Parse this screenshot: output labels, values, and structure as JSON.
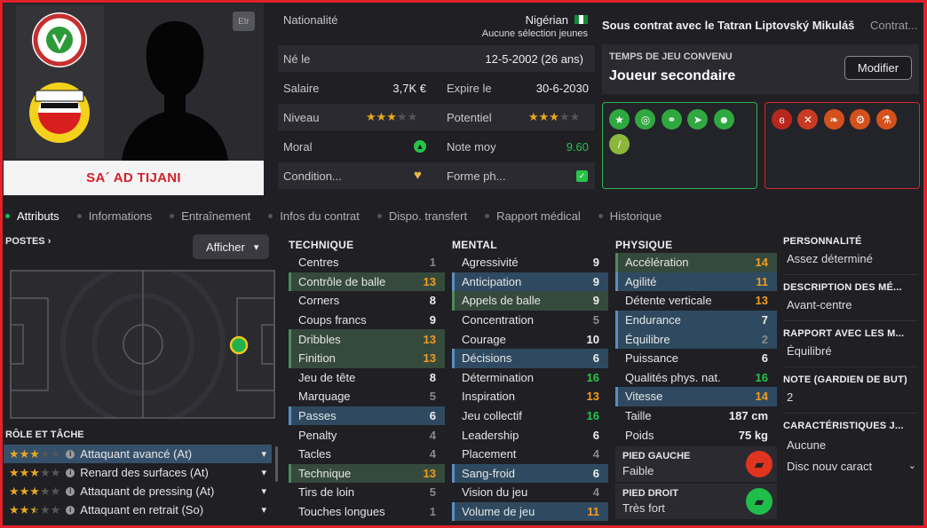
{
  "player": {
    "name": "SA´ AD TIJANI",
    "badge": "Etr"
  },
  "info": {
    "nationality_label": "Nationalité",
    "nationality_value": "Nigérian",
    "nationality_sub": "Aucune sélection jeunes",
    "born_label": "Né le",
    "born_value": "12-5-2002 (26 ans)",
    "salary_label": "Salaire",
    "salary_value": "3,7K €",
    "expire_label": "Expire le",
    "expire_value": "30-6-2030",
    "level_label": "Niveau",
    "level_stars": 3,
    "potential_label": "Potentiel",
    "potential_stars": 3,
    "morale_label": "Moral",
    "avg_label": "Note moy",
    "avg_value": "9.60",
    "condition_label": "Condition...",
    "form_label": "Forme ph..."
  },
  "contract": {
    "title": "Sous contrat avec le Tatran Liptovský Mikuláš",
    "tab": "Contrat...",
    "playtime_label": "TEMPS DE JEU CONVENU",
    "playtime_value": "Joueur secondaire",
    "modify_button": "Modifier"
  },
  "traits": {
    "positive_icons": [
      "star-icon",
      "target-icon",
      "team-icon",
      "run-icon",
      "head-icon",
      "boot-icon"
    ],
    "negative_icons": [
      "lungs-icon",
      "injury-icon",
      "muscle-icon",
      "gears-icon",
      "flask-icon"
    ]
  },
  "tabs": [
    "Attributs",
    "Informations",
    "Entraînement",
    "Infos du contrat",
    "Dispo. transfert",
    "Rapport médical",
    "Historique"
  ],
  "left": {
    "positions_label": "POSTES",
    "show_button": "Afficher",
    "role_header": "RÔLE ET TÂCHE",
    "roles": [
      {
        "stars": 3,
        "label": "Attaquant avancé (At)"
      },
      {
        "stars": 3,
        "label": "Renard des surfaces (At)"
      },
      {
        "stars": 3,
        "label": "Attaquant de pressing (At)"
      },
      {
        "stars": 2.5,
        "label": "Attaquant en retrait (So)"
      }
    ]
  },
  "technique": {
    "header": "TECHNIQUE",
    "items": [
      {
        "label": "Centres",
        "value": "1"
      },
      {
        "label": "Contrôle de balle",
        "value": "13"
      },
      {
        "label": "Corners",
        "value": "8"
      },
      {
        "label": "Coups francs",
        "value": "9"
      },
      {
        "label": "Dribbles",
        "value": "13"
      },
      {
        "label": "Finition",
        "value": "13"
      },
      {
        "label": "Jeu de tête",
        "value": "8"
      },
      {
        "label": "Marquage",
        "value": "5"
      },
      {
        "label": "Passes",
        "value": "6"
      },
      {
        "label": "Penalty",
        "value": "4"
      },
      {
        "label": "Tacles",
        "value": "4"
      },
      {
        "label": "Technique",
        "value": "13"
      },
      {
        "label": "Tirs de loin",
        "value": "5"
      },
      {
        "label": "Touches longues",
        "value": "1"
      }
    ]
  },
  "mental": {
    "header": "MENTAL",
    "items": [
      {
        "label": "Agressivité",
        "value": "9"
      },
      {
        "label": "Anticipation",
        "value": "9"
      },
      {
        "label": "Appels de balle",
        "value": "9"
      },
      {
        "label": "Concentration",
        "value": "5"
      },
      {
        "label": "Courage",
        "value": "10"
      },
      {
        "label": "Décisions",
        "value": "6"
      },
      {
        "label": "Détermination",
        "value": "16"
      },
      {
        "label": "Inspiration",
        "value": "13"
      },
      {
        "label": "Jeu collectif",
        "value": "16"
      },
      {
        "label": "Leadership",
        "value": "6"
      },
      {
        "label": "Placement",
        "value": "4"
      },
      {
        "label": "Sang-froid",
        "value": "6"
      },
      {
        "label": "Vision du jeu",
        "value": "4"
      },
      {
        "label": "Volume de jeu",
        "value": "11"
      }
    ]
  },
  "physique": {
    "header": "PHYSIQUE",
    "items": [
      {
        "label": "Accélération",
        "value": "14"
      },
      {
        "label": "Agilité",
        "value": "11"
      },
      {
        "label": "Détente verticale",
        "value": "13"
      },
      {
        "label": "Endurance",
        "value": "7"
      },
      {
        "label": "Équilibre",
        "value": "2"
      },
      {
        "label": "Puissance",
        "value": "6"
      },
      {
        "label": "Qualités phys. nat.",
        "value": "16"
      },
      {
        "label": "Vitesse",
        "value": "14"
      },
      {
        "label": "Taille",
        "value": "187 cm"
      },
      {
        "label": "Poids",
        "value": "75 kg"
      }
    ],
    "left_foot_label": "PIED GAUCHE",
    "left_foot_value": "Faible",
    "right_foot_label": "PIED DROIT",
    "right_foot_value": "Très fort"
  },
  "side": {
    "personality_label": "PERSONNALITÉ",
    "personality_value": "Assez déterminé",
    "description_label": "DESCRIPTION DES MÉ...",
    "description_value": "Avant-centre",
    "relation_label": "RAPPORT AVEC LES M...",
    "relation_value": "Équilibré",
    "gk_label": "NOTE (GARDIEN DE BUT)",
    "gk_value": "2",
    "traits_label": "CARACTÉRISTIQUES J...",
    "traits_value": "Aucune",
    "traits_select": "Disc nouv caract"
  },
  "colors": {
    "accent_red": "#e0222b",
    "orange": "#f39c1f",
    "green": "#27c44a",
    "selected_blue": "#35506a"
  }
}
